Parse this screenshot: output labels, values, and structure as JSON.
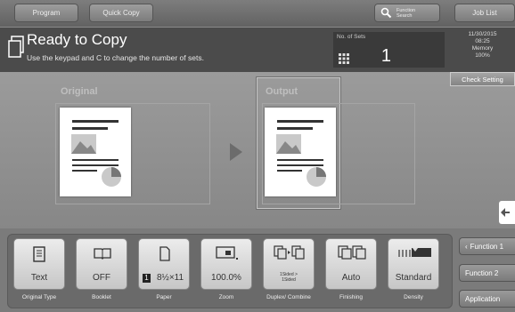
{
  "topbar": {
    "program": "Program",
    "quick_copy": "Quick Copy",
    "function_search": "Function Search",
    "job_list": "Job List"
  },
  "header": {
    "title": "Ready to Copy",
    "subtitle": "Use the keypad and C to change the number of sets.",
    "sets_label": "No. of Sets",
    "sets_value": "1",
    "date": "11/30/2015",
    "time": "08:25",
    "memory_label": "Memory",
    "memory_value": "100%",
    "check_setting": "Check Setting"
  },
  "main": {
    "original_label": "Original",
    "output_label": "Output"
  },
  "functions": [
    {
      "value": "Text",
      "label": "Original Type",
      "icon": "document-text-icon"
    },
    {
      "value": "OFF",
      "label": "Booklet",
      "icon": "book-icon"
    },
    {
      "value": "8½×11",
      "badge": "1",
      "label": "Paper",
      "icon": "paper-icon"
    },
    {
      "value": "100.0%",
      "label": "Zoom",
      "icon": "zoom-icon"
    },
    {
      "value": "1Sided > 1Sided",
      "label": "Duplex/ Combine",
      "icon": "duplex-icon"
    },
    {
      "value": "Auto",
      "label": "Finishing",
      "icon": "finishing-icon"
    },
    {
      "value": "Standard",
      "label": "Density",
      "icon": "density-icon"
    }
  ],
  "side": {
    "function1": "Function 1",
    "function2": "Function 2",
    "application": "Application"
  },
  "colors": {
    "header_bg": "#4b4b4b",
    "button_face": "#e5e5e5"
  }
}
